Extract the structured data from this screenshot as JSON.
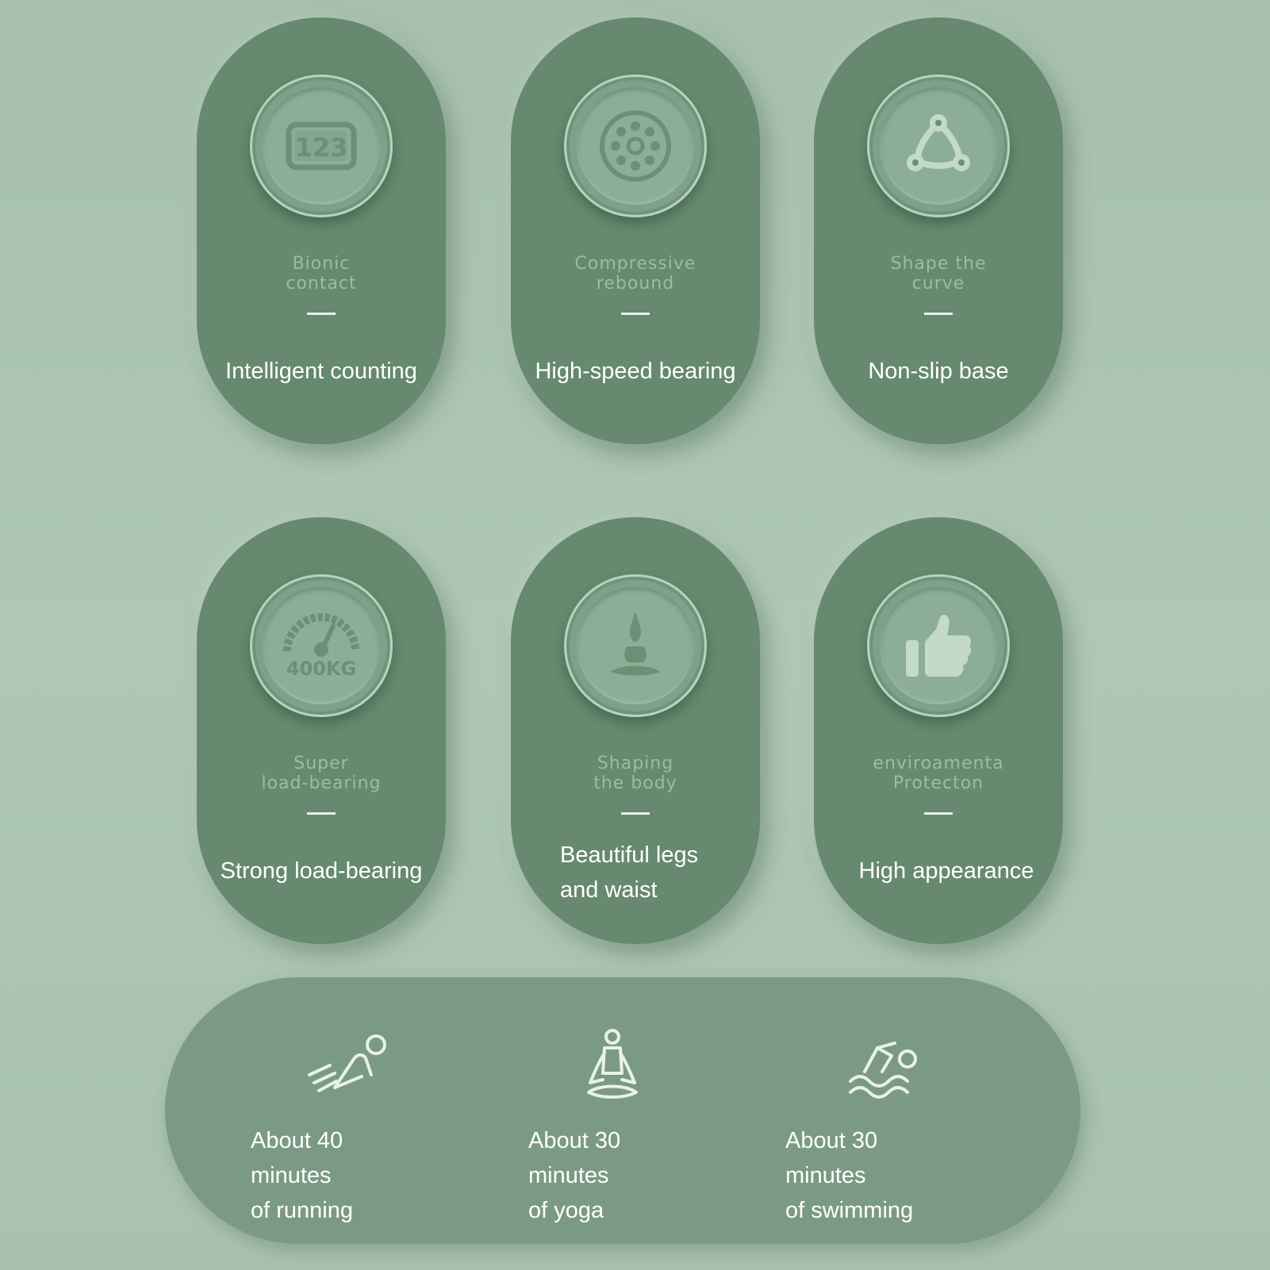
{
  "features": [
    {
      "icon": "counter-123-icon",
      "subtitle": "Bionic\ncontact",
      "title": "Intelligent counting"
    },
    {
      "icon": "bearing-icon",
      "subtitle": "Compressive\nrebound",
      "title": "High-speed bearing"
    },
    {
      "icon": "tripod-icon",
      "subtitle": "Shape the\ncurve",
      "title": "Non-slip base"
    },
    {
      "icon": "gauge-400kg-icon",
      "subtitle": "Super\nload-bearing",
      "title": "Strong load-bearing"
    },
    {
      "icon": "meditation-figure-icon",
      "subtitle": "Shaping\nthe body",
      "title": "Beautiful legs\nand waist"
    },
    {
      "icon": "thumbs-up-icon",
      "subtitle": "enviroamenta\nProtecton",
      "title": "High appearance"
    }
  ],
  "badge_labels": {
    "counter": "123",
    "gauge": "400KG"
  },
  "activities": [
    {
      "icon": "running-icon",
      "text": "About 40 minutes\nof running"
    },
    {
      "icon": "yoga-icon",
      "text": "About 30 minutes\nof yoga"
    },
    {
      "icon": "swimming-icon",
      "text": "About 30 minutes\nof swimming"
    }
  ],
  "colors": {
    "card": "#66896f",
    "badge": "#8cad96",
    "bottom_panel": "#7b9a84",
    "text": "#ffffff",
    "subtitle": "#9dbba5"
  }
}
